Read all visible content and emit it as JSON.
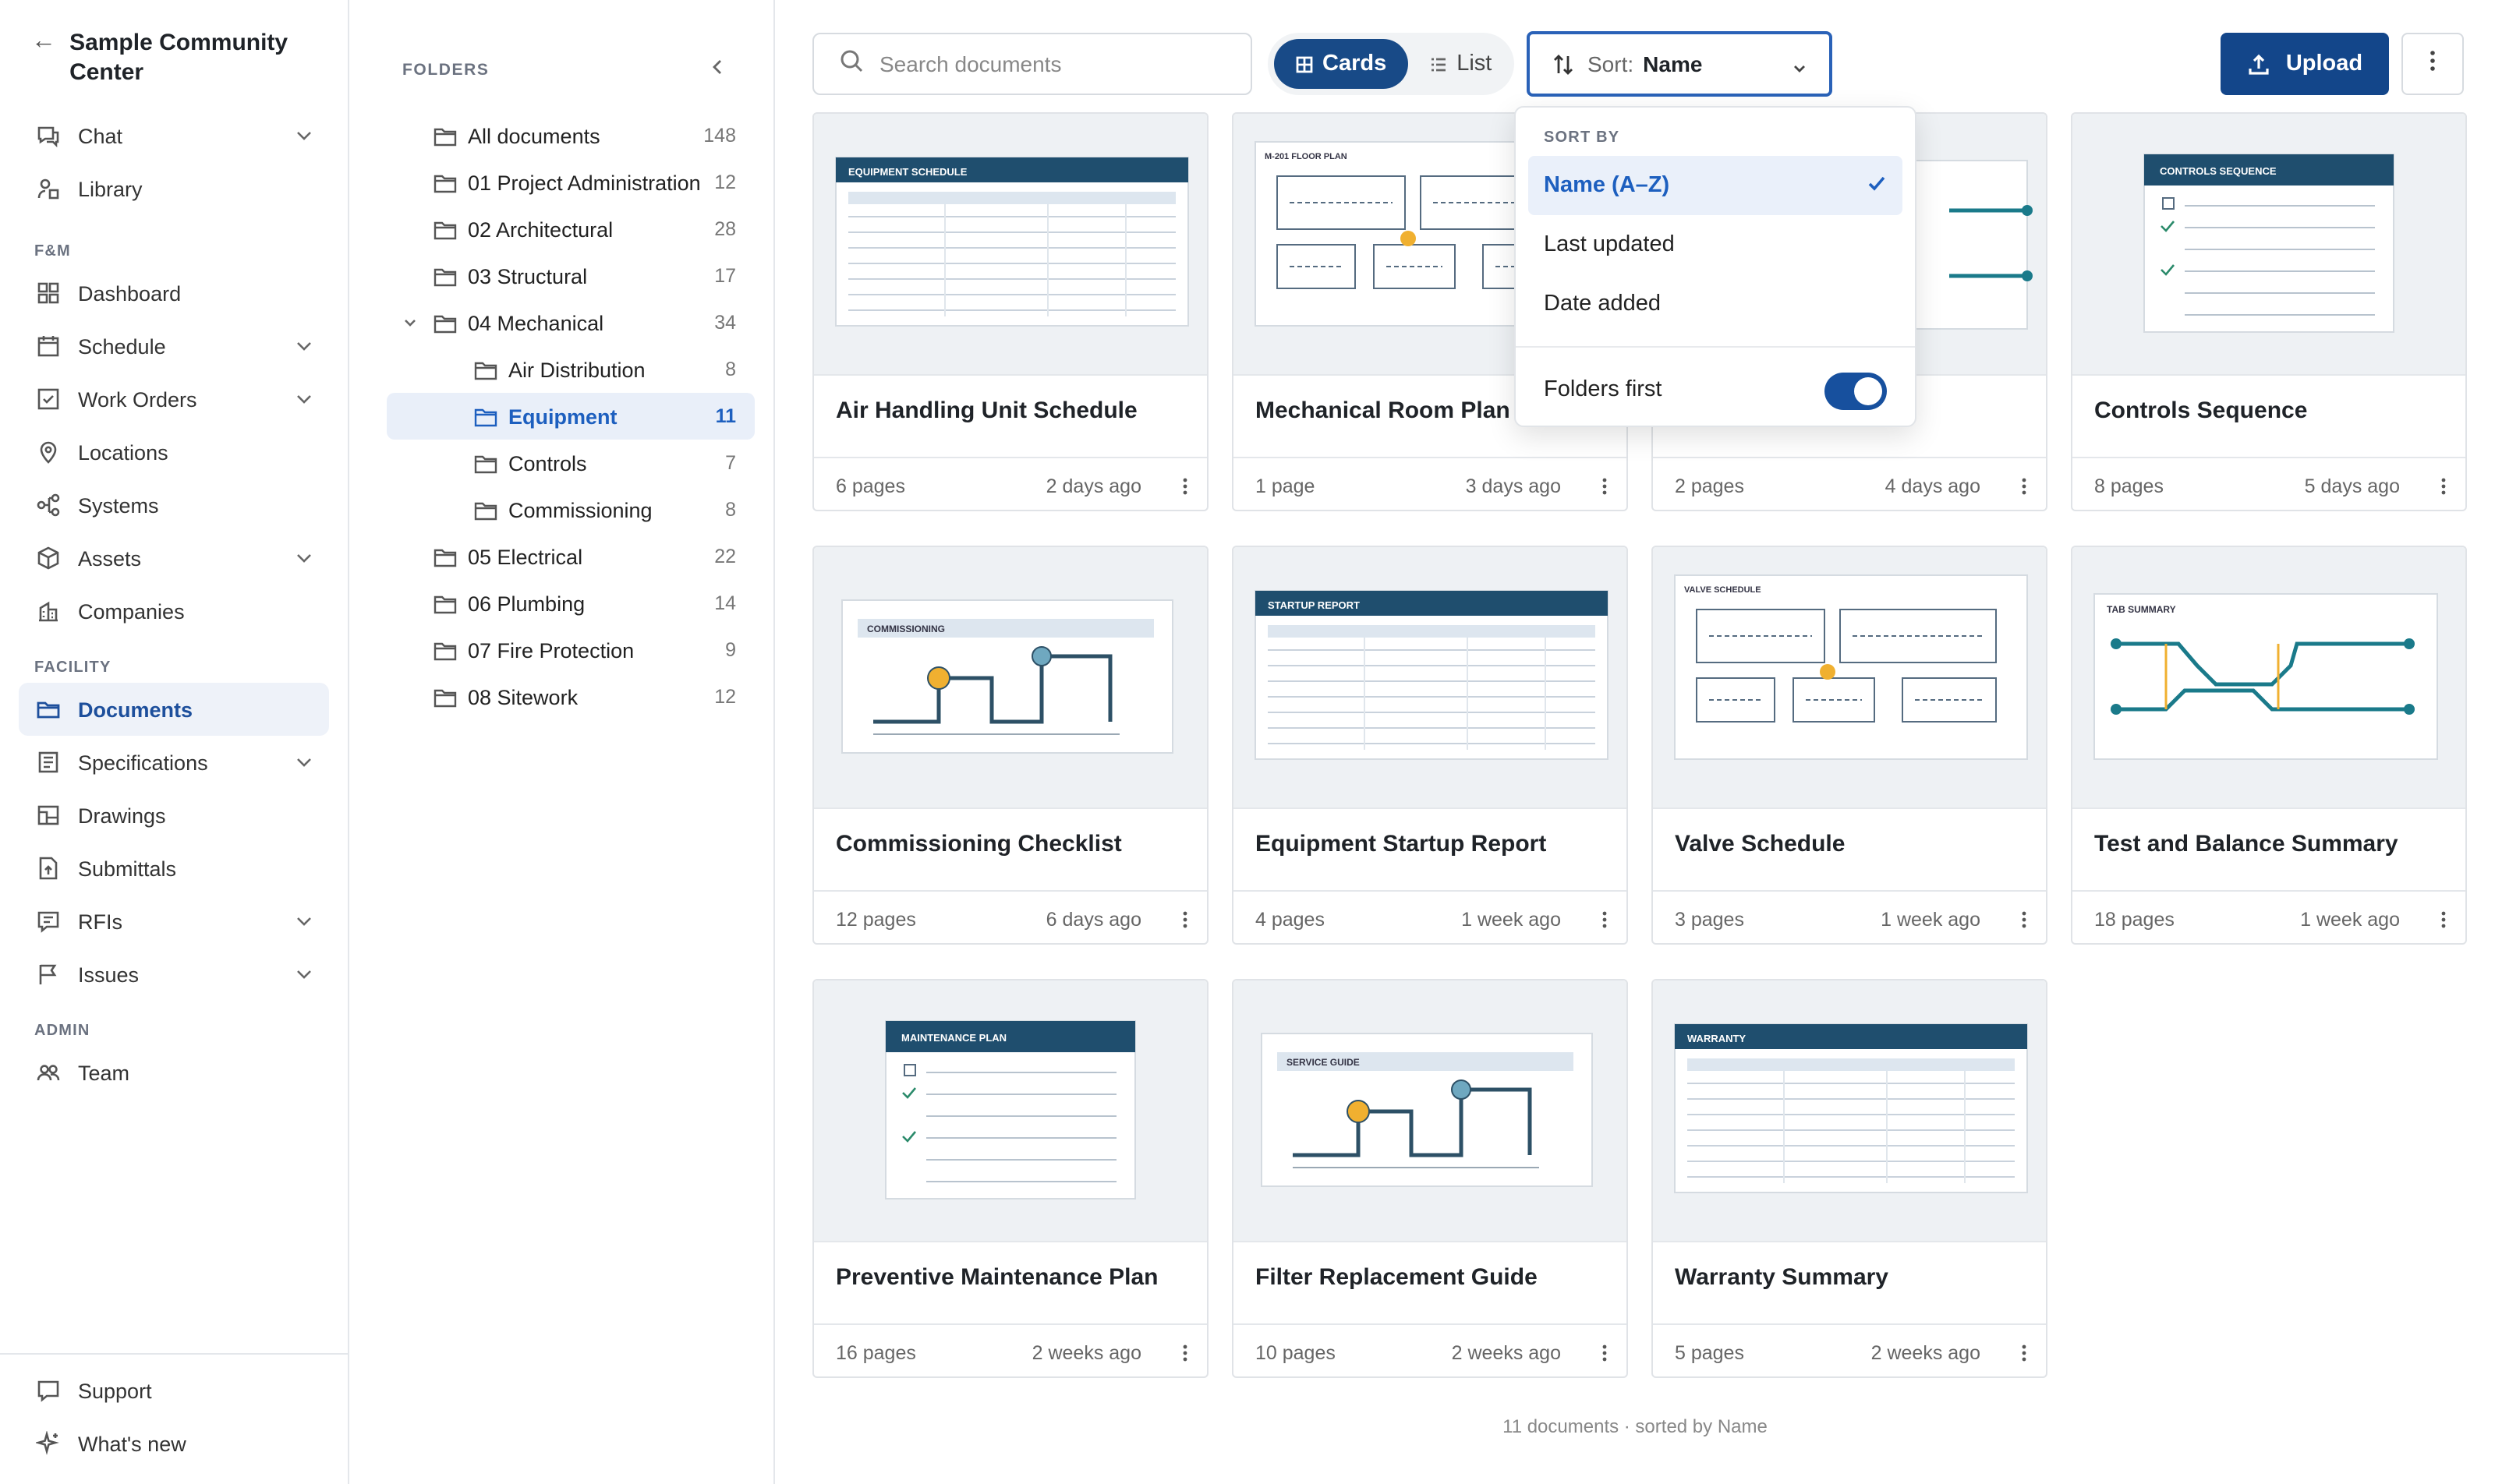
{
  "project": {
    "title": "Sample Community Center"
  },
  "sidebar": {
    "top_items": [
      {
        "label": "Chat",
        "icon": "chat-icon"
      },
      {
        "label": "Library",
        "icon": "library-icon"
      }
    ],
    "sections": [
      {
        "title": "F&M",
        "items": [
          {
            "label": "Dashboard"
          },
          {
            "label": "Schedule"
          },
          {
            "label": "Work Orders"
          },
          {
            "label": "Locations"
          },
          {
            "label": "Systems"
          },
          {
            "label": "Assets"
          },
          {
            "label": "Companies"
          }
        ]
      },
      {
        "title": "FACILITY",
        "items": [
          {
            "label": "Documents"
          },
          {
            "label": "Specifications"
          },
          {
            "label": "Drawings"
          },
          {
            "label": "Submittals"
          },
          {
            "label": "RFIs"
          },
          {
            "label": "Issues"
          }
        ]
      },
      {
        "title": "ADMIN",
        "items": [
          {
            "label": "Team"
          }
        ]
      }
    ],
    "bottom": [
      {
        "label": "Support"
      },
      {
        "label": "What's new"
      }
    ]
  },
  "folders": {
    "title": "FOLDERS",
    "items": [
      {
        "label": "All documents",
        "count": "148"
      },
      {
        "label": "01 Project Administration",
        "count": "12"
      },
      {
        "label": "02 Architectural",
        "count": "28"
      },
      {
        "label": "03 Structural",
        "count": "17"
      },
      {
        "label": "04 Mechanical",
        "count": "34"
      },
      {
        "label": "Air Distribution",
        "count": "8"
      },
      {
        "label": "Equipment",
        "count": "11"
      },
      {
        "label": "Controls",
        "count": "7"
      },
      {
        "label": "Commissioning",
        "count": "8"
      },
      {
        "label": "05 Electrical",
        "count": "22"
      },
      {
        "label": "06 Plumbing",
        "count": "14"
      },
      {
        "label": "07 Fire Protection",
        "count": "9"
      },
      {
        "label": "08 Sitework",
        "count": "12"
      }
    ]
  },
  "toolbar": {
    "search_placeholder": "Search documents",
    "view_cards": "Cards",
    "view_list": "List",
    "sort_label": "Sort:",
    "sort_value": "Name",
    "upload": "Upload"
  },
  "sort_menu": {
    "title": "SORT BY",
    "options": [
      "Name (A–Z)",
      "Last updated",
      "Date added"
    ],
    "toggle_label": "Folders first",
    "toggle_on": true
  },
  "documents": [
    {
      "title": "Air Handling Unit Schedule",
      "pages": "6 pages",
      "ago": "2 days ago",
      "thumb_label": "EQUIPMENT SCHEDULE"
    },
    {
      "title": "Mechanical Room Plan",
      "pages": "1 page",
      "ago": "3 days ago",
      "thumb_label": "M-201 FLOOR PLAN"
    },
    {
      "title": "",
      "pages": "2 pages",
      "ago": "4 days ago",
      "thumb_label": ""
    },
    {
      "title": "Controls Sequence",
      "pages": "8 pages",
      "ago": "5 days ago",
      "thumb_label": "CONTROLS SEQUENCE"
    },
    {
      "title": "Commissioning Checklist",
      "pages": "12 pages",
      "ago": "6 days ago",
      "thumb_label": "COMMISSIONING"
    },
    {
      "title": "Equipment Startup Report",
      "pages": "4 pages",
      "ago": "1 week ago",
      "thumb_label": "STARTUP REPORT"
    },
    {
      "title": "Valve Schedule",
      "pages": "3 pages",
      "ago": "1 week ago",
      "thumb_label": "VALVE SCHEDULE"
    },
    {
      "title": "Test and Balance Summary",
      "pages": "18 pages",
      "ago": "1 week ago",
      "thumb_label": "TAB SUMMARY"
    },
    {
      "title": "Preventive Maintenance Plan",
      "pages": "16 pages",
      "ago": "2 weeks ago",
      "thumb_label": "MAINTENANCE PLAN"
    },
    {
      "title": "Filter Replacement Guide",
      "pages": "10 pages",
      "ago": "2 weeks ago",
      "thumb_label": "SERVICE GUIDE"
    },
    {
      "title": "Warranty Summary",
      "pages": "5 pages",
      "ago": "2 weeks ago",
      "thumb_label": "WARRANTY"
    }
  ],
  "footer": "11 documents · sorted by Name",
  "colors": {
    "accent": "#13468a",
    "thumb_header": "#1f4e6e",
    "orange": "#f0b030",
    "teal": "#1a7a8a"
  }
}
